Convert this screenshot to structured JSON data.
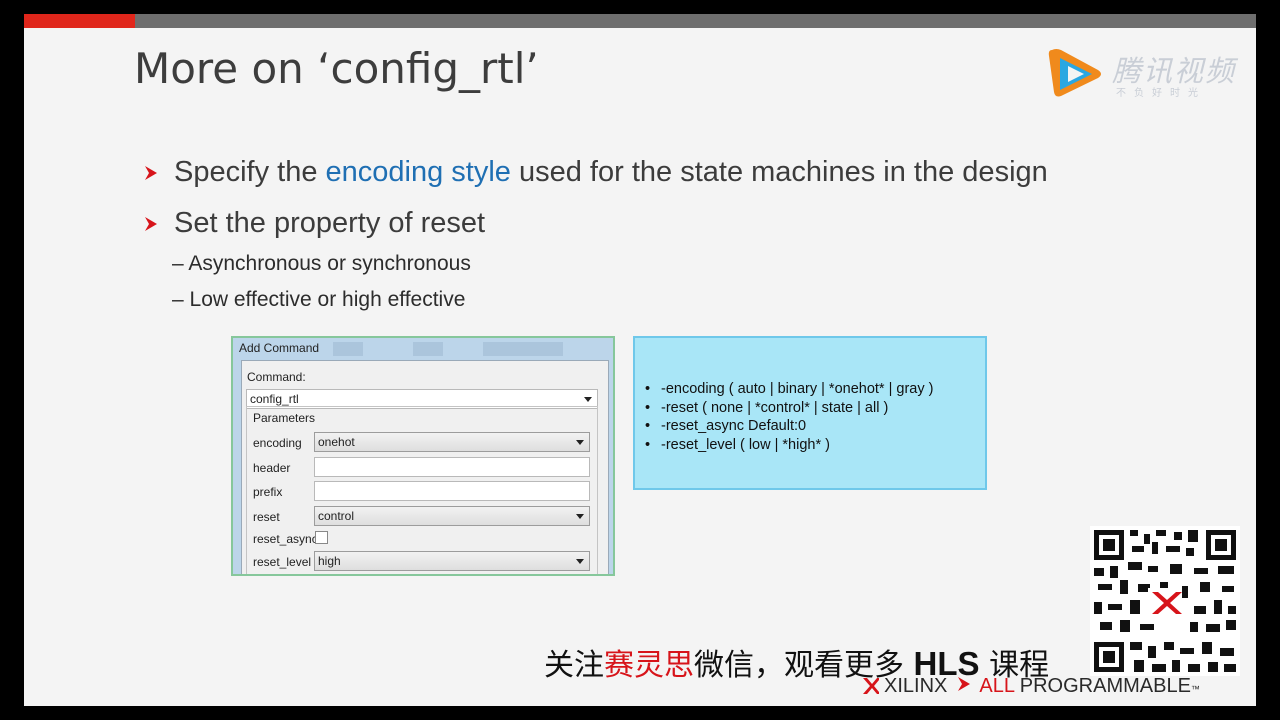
{
  "slide": {
    "title": "More on ‘config_rtl’",
    "bullets": [
      {
        "before": "Specify the ",
        "highlight": "encoding style",
        "after": " used for the state machines in the design"
      },
      {
        "text": "Set the property of reset"
      }
    ],
    "sub_bullets": [
      "– Asynchronous or synchronous",
      "– Low effective or high effective"
    ]
  },
  "dialog": {
    "title": "Add Command",
    "command_label": "Command:",
    "command_value": "config_rtl",
    "parameters_label": "Parameters",
    "fields": [
      {
        "label": "encoding",
        "value": "onehot",
        "type": "dropdown"
      },
      {
        "label": "header",
        "value": "",
        "type": "text"
      },
      {
        "label": "prefix",
        "value": "",
        "type": "text"
      },
      {
        "label": "reset",
        "value": "control",
        "type": "dropdown"
      },
      {
        "label": "reset_async",
        "value": "",
        "type": "checkbox"
      },
      {
        "label": "reset_level",
        "value": "high",
        "type": "dropdown"
      }
    ]
  },
  "info_box": {
    "items": [
      "-encoding  ( auto | binary | *onehot* | gray )",
      "-reset  ( none | *control* | state | all )",
      "-reset_async Default:0",
      "-reset_level  ( low | *high* )"
    ]
  },
  "watermark": {
    "name": "腾讯视频",
    "slogan": "不负好时光"
  },
  "promo": {
    "part1": "关注",
    "part2": "赛灵思",
    "part3": "微信，观看更多 ",
    "part4": "HLS",
    "part5": " 课程"
  },
  "brand": {
    "company": "XILINX",
    "tagline_a": "ALL",
    "tagline_b": " PROGRAMMABLE",
    "tm": "™"
  },
  "colors": {
    "accent": "#e0261b",
    "link": "#1f6fb3",
    "info_bg": "#a9e6f7"
  }
}
